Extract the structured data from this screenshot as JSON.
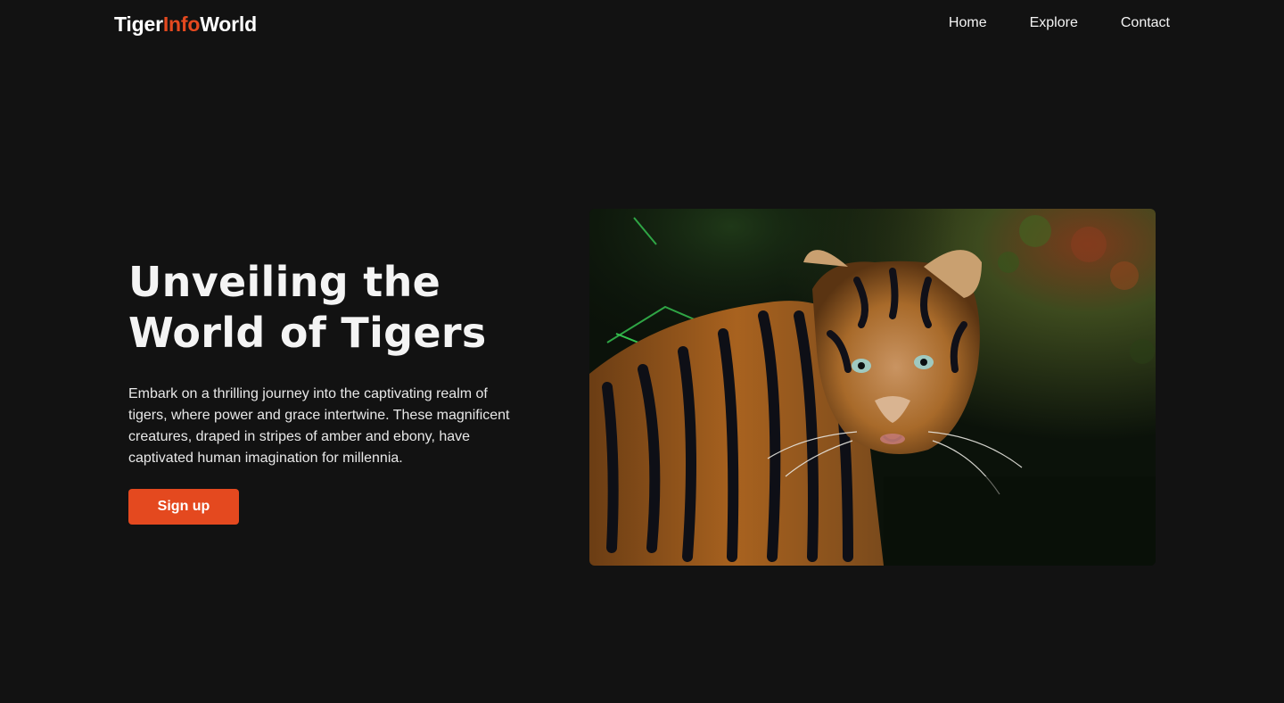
{
  "brand": {
    "part1": "Tiger",
    "part2": "Info",
    "part3": "World",
    "accent_color": "#e4491f"
  },
  "nav": {
    "items": [
      {
        "label": "Home"
      },
      {
        "label": "Explore"
      },
      {
        "label": "Contact"
      }
    ]
  },
  "hero": {
    "title_line1": "Unveiling the",
    "title_line2": "World of Tigers",
    "description": "Embark on a thrilling journey into the captivating realm of tigers, where power and grace intertwine. These magnificent creatures, draped in stripes of amber and ebony, have captivated human imagination for millennia.",
    "cta_label": "Sign up",
    "image_icon": "tiger-photo-icon"
  },
  "colors": {
    "background": "#121212",
    "text": "#f2f2f2",
    "accent": "#e4491f"
  }
}
